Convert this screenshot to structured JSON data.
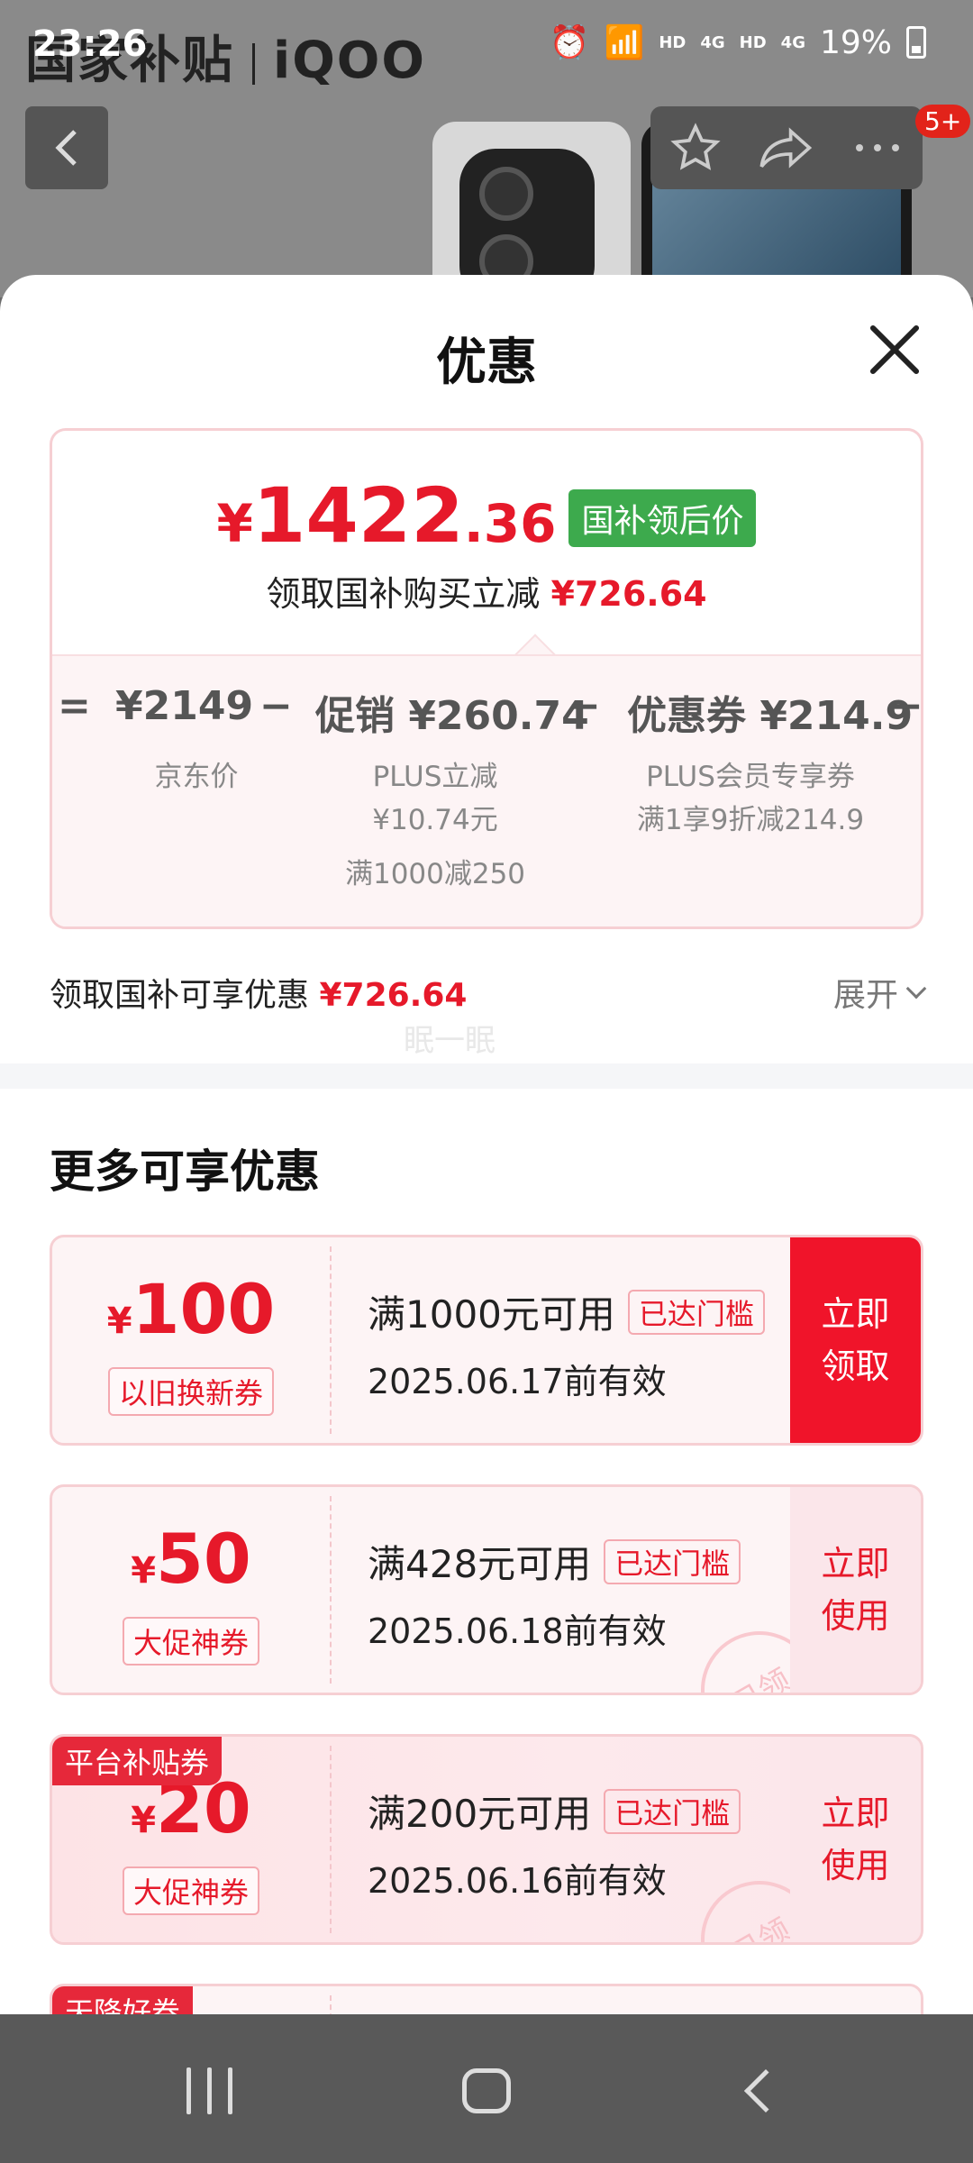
{
  "status_bar": {
    "time": "23:26",
    "battery": "19%",
    "net_labels": [
      "HD",
      "4G",
      "HD",
      "4G"
    ]
  },
  "background_page": {
    "banner_left": "国家补贴",
    "banner_right": "iQOO",
    "cart_badge": "5+"
  },
  "sheet": {
    "title": "优惠"
  },
  "price_card": {
    "final_price_symbol": "¥",
    "final_price_int": "1422",
    "final_price_dec": ".36",
    "final_price_tag": "国补领后价",
    "subsidy_text": "领取国补购买立减",
    "subsidy_amount": "¥726.64",
    "calc": {
      "eq": "=",
      "jd_price": "¥2149",
      "minus1": "−",
      "promo": "促销 ¥260.74",
      "minus2": "−",
      "coupon": "优惠券 ¥214.9",
      "minus3": "−",
      "jd_label": "京东价",
      "promo_sub1": "PLUS立减",
      "promo_sub2": "¥10.74元",
      "promo_sub3": "满1000减250",
      "coupon_sub1": "PLUS会员专享券",
      "coupon_sub2": "满1享9折减214.9"
    }
  },
  "summary": {
    "label": "领取国补可享优惠",
    "amount": "¥726.64",
    "expand": "展开",
    "watermark": "眠一眠"
  },
  "more_section": {
    "title": "更多可享优惠"
  },
  "coupons": [
    {
      "symbol": "¥",
      "amount": "100",
      "kind": "以旧换新券",
      "condition": "满1000元可用",
      "reach": "已达门槛",
      "valid": "2025.06.17前有效",
      "action": "立即领取"
    },
    {
      "symbol": "¥",
      "amount": "50",
      "kind": "大促神券",
      "condition": "满428元可用",
      "reach": "已达门槛",
      "valid": "2025.06.18前有效",
      "action": "立即使用",
      "stamp": "已领"
    },
    {
      "corner": "平台补贴券",
      "symbol": "¥",
      "amount": "20",
      "kind": "大促神券",
      "condition": "满200元可用",
      "reach": "已达门槛",
      "valid": "2025.06.16前有效",
      "action": "立即使用",
      "stamp": "已领"
    },
    {
      "corner": "天降好券"
    }
  ],
  "colors": {
    "accent_red": "#e6192a",
    "tag_green": "#3daa4d"
  }
}
